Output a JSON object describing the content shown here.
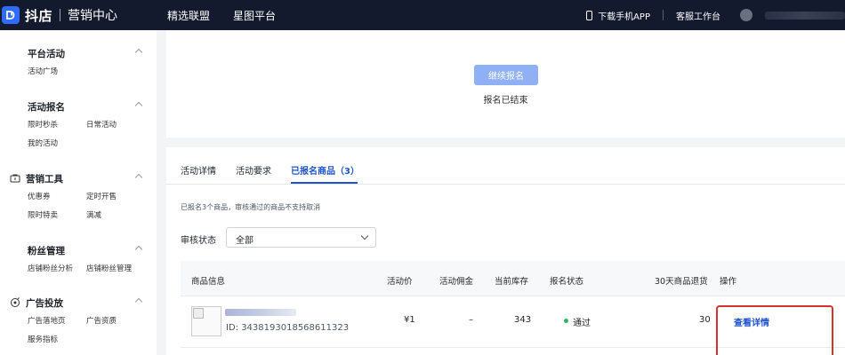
{
  "header": {
    "logo_text": "抖店",
    "logo_sub": "营销中心",
    "nav": [
      "精选联盟",
      "星图平台"
    ],
    "download_app": "下载手机APP",
    "customer_service": "客服工作台"
  },
  "sidebar": {
    "groups": [
      {
        "title": "平台活动",
        "items": [
          "活动广场"
        ]
      },
      {
        "title": "活动报名",
        "items": [
          "限时秒杀",
          "日常活动",
          "我的活动"
        ]
      },
      {
        "title": "营销工具",
        "icon": "coupon-tool-icon",
        "items": [
          "优惠券",
          "定时开售",
          "限时特卖",
          "满减"
        ]
      },
      {
        "title": "粉丝管理",
        "items": [
          "店铺粉丝分析",
          "店铺粉丝管理"
        ]
      },
      {
        "title": "广告投放",
        "icon": "ad-target-icon",
        "items": [
          "广告落地页",
          "广告资质",
          "服务指标"
        ]
      }
    ]
  },
  "signup": {
    "continue_button": "继续报名",
    "ended_text": "报名已结束"
  },
  "tabs": [
    "活动详情",
    "活动要求",
    "已报名商品（3）"
  ],
  "notice": "已报名3个商品，审核通过的商品不支持取消",
  "filter": {
    "label": "审核状态",
    "value": "全部"
  },
  "table": {
    "headers": [
      "商品信息",
      "活动价",
      "活动佣金",
      "当前库存",
      "报名状态",
      "30天商品退货",
      "操作"
    ],
    "rows": [
      {
        "product_id": "ID: 3438193018568611323",
        "price": "¥1",
        "commission": "–",
        "stock": "343",
        "status": "通过",
        "returns_30d": "30",
        "action": "查看详情"
      }
    ]
  },
  "colors": {
    "topbar": "#141a2d",
    "accent": "#1f53cc",
    "button_disabled": "#8fb0f5",
    "status_pass": "#2fb56a",
    "highlight_box": "#d9302c"
  }
}
